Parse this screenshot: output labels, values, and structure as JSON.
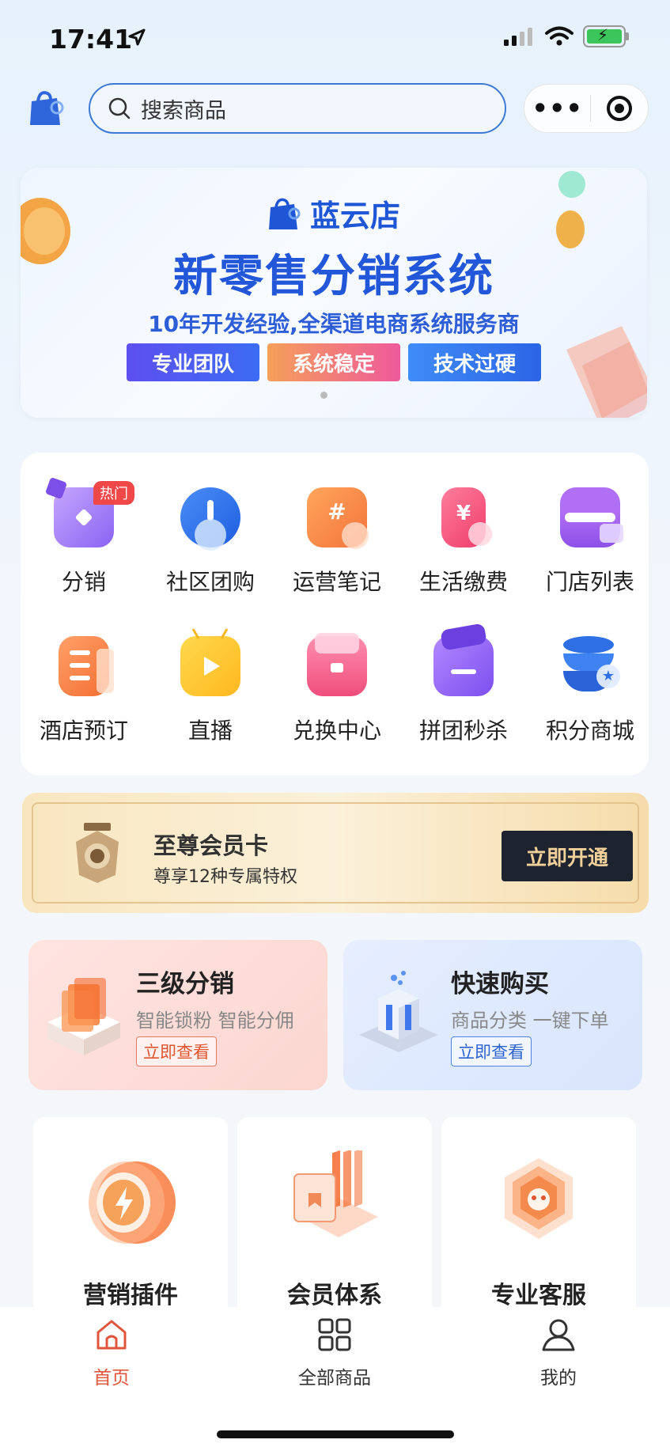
{
  "status_bar": {
    "time": "17:41"
  },
  "search": {
    "placeholder": "搜索商品"
  },
  "banner": {
    "brand": "蓝云店",
    "title": "新零售分销系统",
    "subtitle": "10年开发经验,全渠道电商系统服务商",
    "tags": [
      "专业团队",
      "系统稳定",
      "技术过硬"
    ]
  },
  "grid": {
    "hot_badge": "热门",
    "items": [
      {
        "label": "分销",
        "icon": "distribution-icon"
      },
      {
        "label": "社区团购",
        "icon": "community-group-buy-icon"
      },
      {
        "label": "运营笔记",
        "icon": "operation-notes-icon"
      },
      {
        "label": "生活缴费",
        "icon": "bill-payment-icon"
      },
      {
        "label": "门店列表",
        "icon": "store-list-icon"
      },
      {
        "label": "酒店预订",
        "icon": "hotel-booking-icon"
      },
      {
        "label": "直播",
        "icon": "live-stream-icon"
      },
      {
        "label": "兑换中心",
        "icon": "redeem-center-icon"
      },
      {
        "label": "拼团秒杀",
        "icon": "group-flash-sale-icon"
      },
      {
        "label": "积分商城",
        "icon": "points-mall-icon"
      }
    ]
  },
  "vip": {
    "title": "至尊会员卡",
    "subtitle": "尊享12种专属特权",
    "button": "立即开通"
  },
  "promos": [
    {
      "title": "三级分销",
      "subtitle": "智能锁粉 智能分佣",
      "button": "立即查看"
    },
    {
      "title": "快速购买",
      "subtitle": "商品分类 一键下单",
      "button": "立即查看"
    }
  ],
  "features": [
    {
      "title": "营销插件"
    },
    {
      "title": "会员体系"
    },
    {
      "title": "专业客服"
    }
  ],
  "tabbar": [
    {
      "label": "首页",
      "icon": "home-icon"
    },
    {
      "label": "全部商品",
      "icon": "grid-icon"
    },
    {
      "label": "我的",
      "icon": "user-icon"
    }
  ],
  "colors": {
    "brand_blue": "#2357d9",
    "active_tab": "#e0553c",
    "vip_button": "#1e2330"
  }
}
